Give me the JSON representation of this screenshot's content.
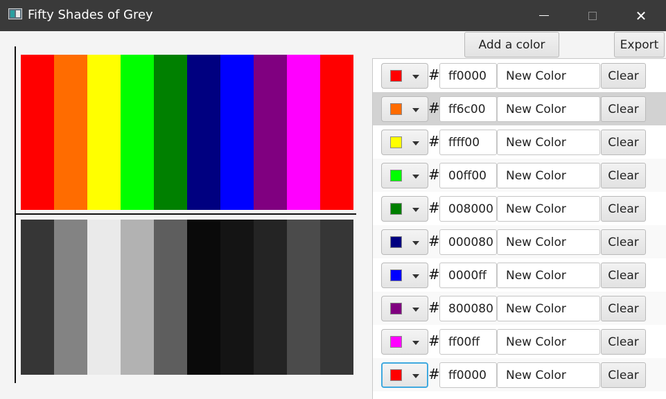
{
  "window": {
    "title": "Fifty Shades of Grey",
    "icons": {
      "app": "app-window-icon",
      "minimize": "minimize-icon",
      "maximize": "maximize-icon",
      "close": "close-icon"
    },
    "close_glyph": "✕"
  },
  "toolbar": {
    "add_label": "Add a color",
    "export_label": "Export"
  },
  "canvas": {
    "color_strip": [
      "#ff0000",
      "#ff6c00",
      "#ffff00",
      "#00ff00",
      "#008000",
      "#000080",
      "#0000ff",
      "#800080",
      "#ff00ff",
      "#ff0000"
    ],
    "grey_strip": [
      "#363636",
      "#838383",
      "#eaeaea",
      "#b2b2b2",
      "#5e5e5e",
      "#0a0a0a",
      "#141414",
      "#242424",
      "#4b4b4b",
      "#363636"
    ]
  },
  "color_list": {
    "hash_symbol": "#",
    "rows": [
      {
        "swatch": "#ff0000",
        "hex": "ff0000",
        "name": "New Color",
        "clear_label": "Clear"
      },
      {
        "swatch": "#ff6c00",
        "hex": "ff6c00",
        "name": "New Color",
        "clear_label": "Clear"
      },
      {
        "swatch": "#ffff00",
        "hex": "ffff00",
        "name": "New Color",
        "clear_label": "Clear"
      },
      {
        "swatch": "#00ff00",
        "hex": "00ff00",
        "name": "New Color",
        "clear_label": "Clear"
      },
      {
        "swatch": "#008000",
        "hex": "008000",
        "name": "New Color",
        "clear_label": "Clear"
      },
      {
        "swatch": "#000080",
        "hex": "000080",
        "name": "New Color",
        "clear_label": "Clear"
      },
      {
        "swatch": "#0000ff",
        "hex": "0000ff",
        "name": "New Color",
        "clear_label": "Clear"
      },
      {
        "swatch": "#800080",
        "hex": "800080",
        "name": "New Color",
        "clear_label": "Clear"
      },
      {
        "swatch": "#ff00ff",
        "hex": "ff00ff",
        "name": "New Color",
        "clear_label": "Clear"
      },
      {
        "swatch": "#ff0000",
        "hex": "ff0000",
        "name": "New Color",
        "clear_label": "Clear"
      }
    ]
  }
}
